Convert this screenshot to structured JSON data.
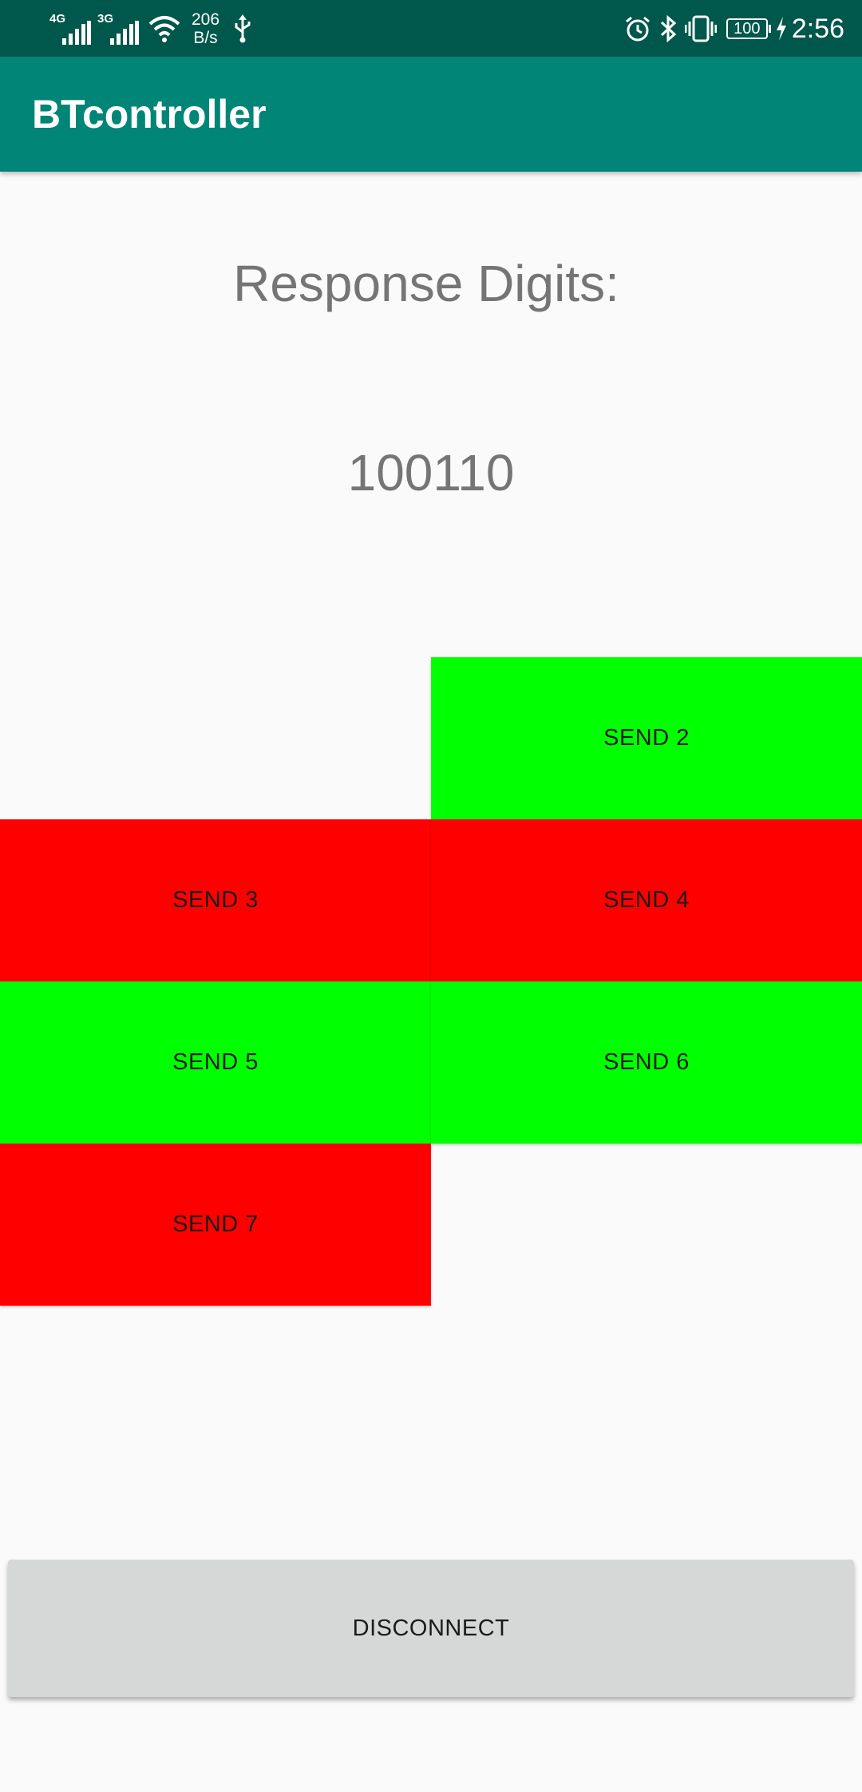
{
  "status_bar": {
    "network_1": "4G",
    "network_2": "3G",
    "speed_value": "206",
    "speed_unit": "B/s",
    "battery": "100",
    "time": "2:56"
  },
  "app_bar": {
    "title": "BTcontroller"
  },
  "main": {
    "response_label": "Response Digits:",
    "response_value": "100110",
    "buttons": [
      {
        "label": "SEND 2",
        "color": "#00ff00"
      },
      {
        "label": "SEND 3",
        "color": "#ff0000"
      },
      {
        "label": "SEND 4",
        "color": "#ff0000"
      },
      {
        "label": "SEND 5",
        "color": "#00ff00"
      },
      {
        "label": "SEND 6",
        "color": "#00ff00"
      },
      {
        "label": "SEND 7",
        "color": "#ff0000"
      }
    ],
    "disconnect_label": "DISCONNECT"
  },
  "colors": {
    "status_bar": "#00574b",
    "app_bar": "#008577",
    "active": "#00ff00",
    "inactive": "#ff0000",
    "disconnect_bg": "#d6d7d7"
  },
  "icons": [
    "signal-icon",
    "wifi-icon",
    "usb-icon",
    "alarm-icon",
    "bluetooth-icon",
    "vibrate-icon",
    "battery-icon",
    "charging-icon"
  ]
}
